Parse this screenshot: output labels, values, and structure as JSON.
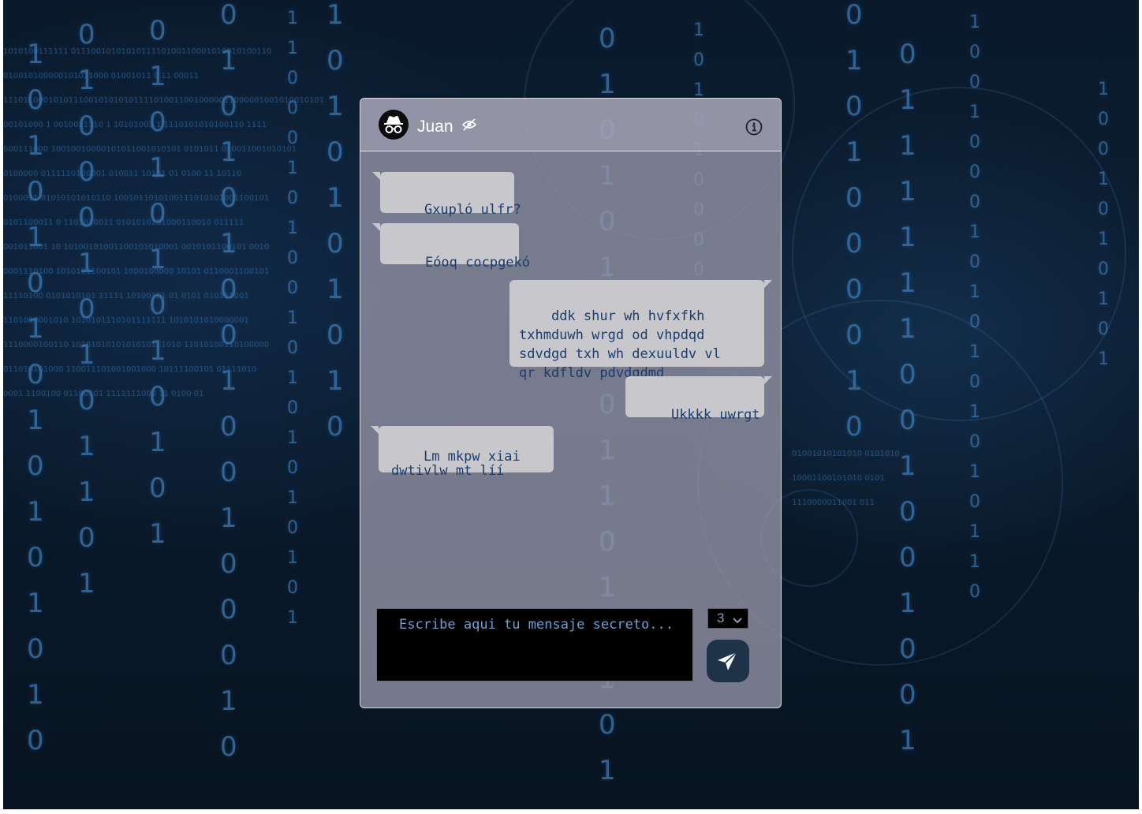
{
  "contact": {
    "name": "Juan",
    "status_icon": "eye-slash-icon",
    "avatar_icon": "incognito-icon",
    "info_icon": "info-icon"
  },
  "messages": [
    {
      "direction": "incoming",
      "text": "Gxupló ulfr?"
    },
    {
      "direction": "incoming",
      "text": "Eóoq cocpgekó"
    },
    {
      "direction": "outgoing",
      "text": "ddk shur wh hvfxfkh\ntxhmduwh wrgd od vhpdqd\nsdvdgd txh wh dexuuldv vl\nqr kdfldv pdvdqdmd"
    },
    {
      "direction": "outgoing",
      "text": "Ukkkk uwrgt"
    },
    {
      "direction": "incoming",
      "text": "Lm mkpw xiai\ndwtivlw mt líí"
    }
  ],
  "composer": {
    "placeholder": "Escribe aqui tu mensaje secreto...",
    "value": ""
  },
  "ttl_select": {
    "selected": "3",
    "icon": "chevron-down-icon"
  },
  "send_button": {
    "icon": "paper-plane-icon"
  },
  "colors": {
    "bubble": "#c8c8cc",
    "bubble_text": "#1a3d6e",
    "panel": "#9696a8",
    "send_button": "#1e3347"
  }
}
